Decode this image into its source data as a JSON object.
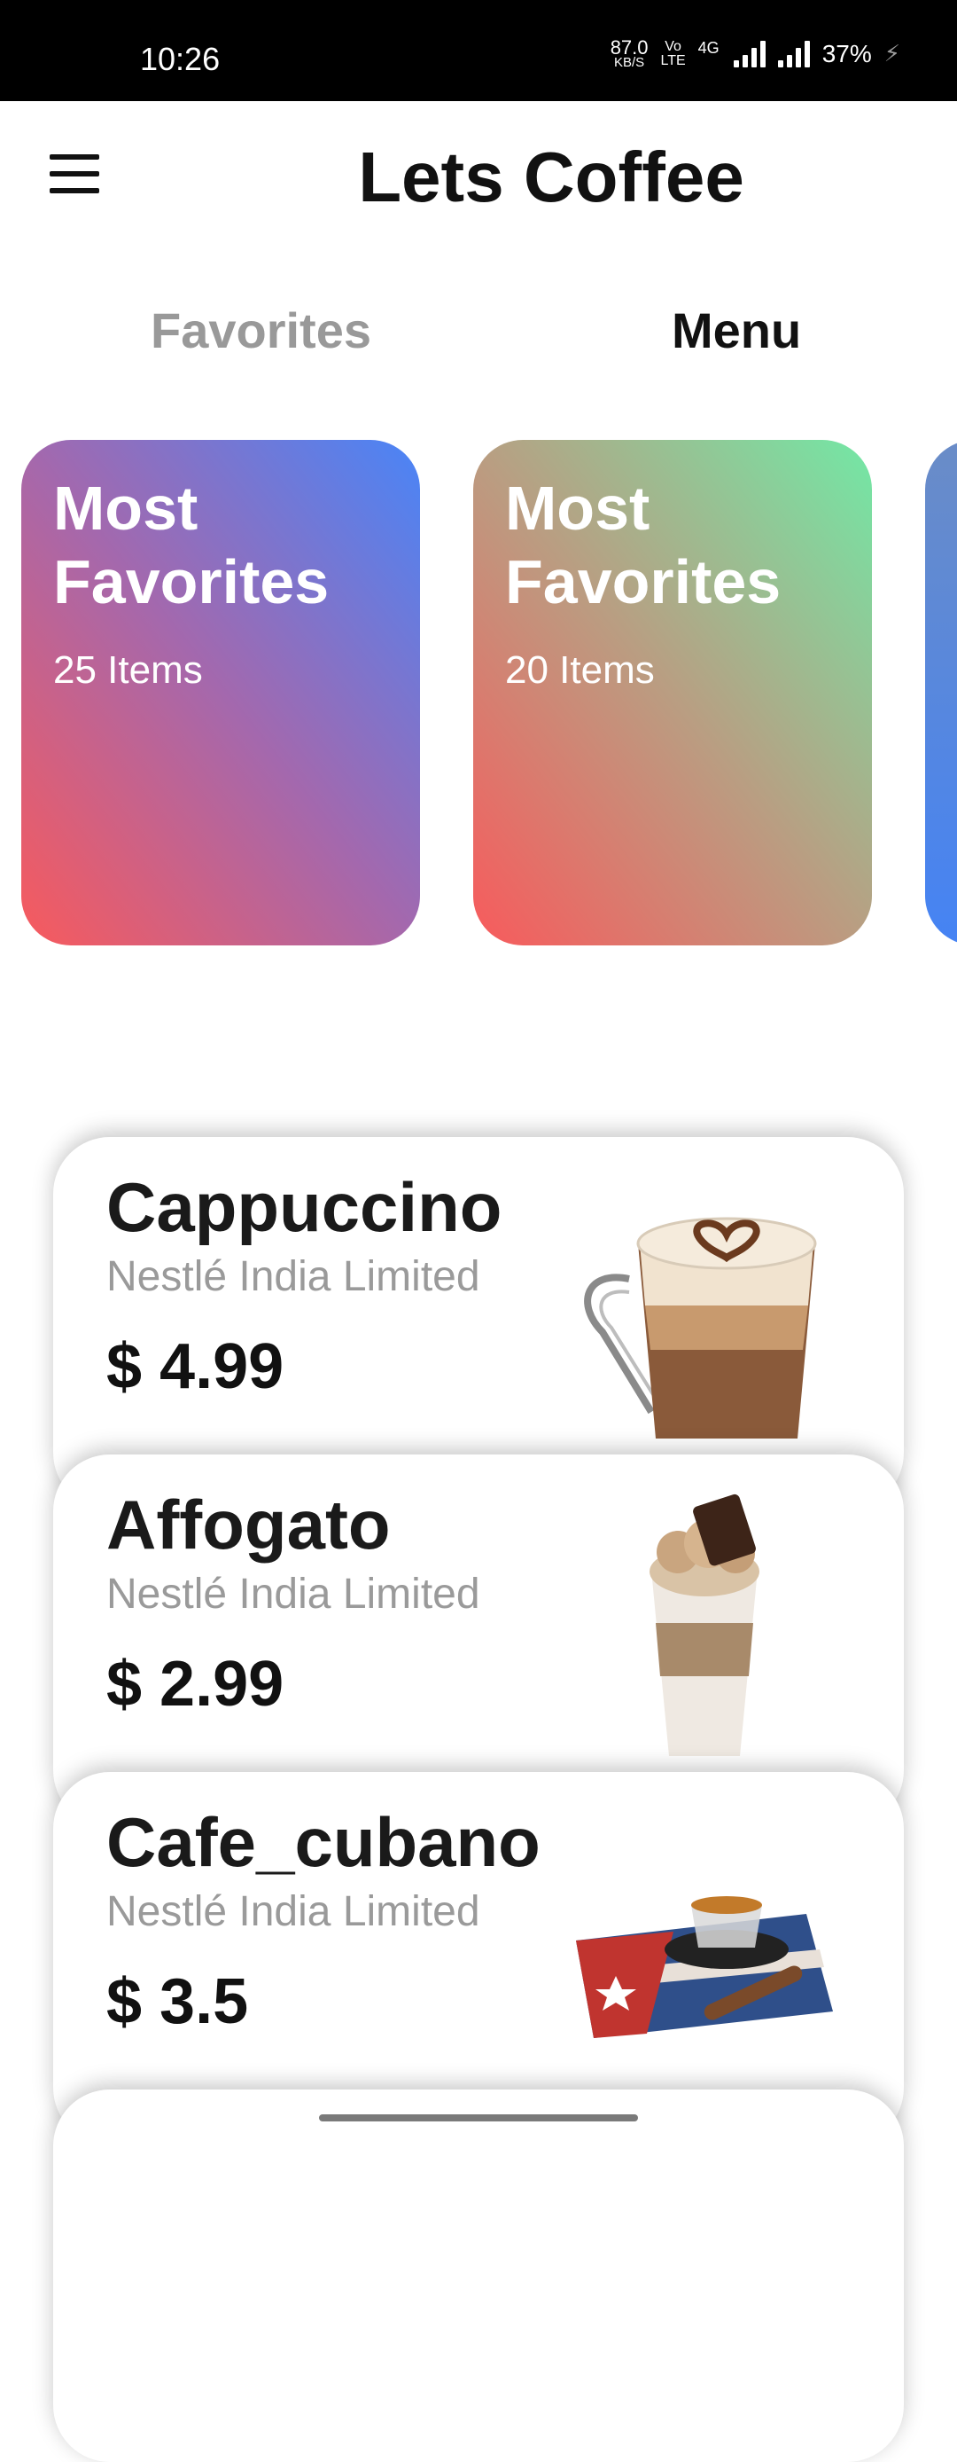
{
  "status_bar": {
    "time": "10:26",
    "net_speed_value": "87.0",
    "net_speed_unit": "KB/S",
    "volte_top": "Vo",
    "volte_bottom": "LTE",
    "network_type": "4G",
    "battery": "37%"
  },
  "app_bar": {
    "title": "Lets Coffee",
    "menu_icon": "hamburger-menu-icon"
  },
  "tabs": [
    {
      "label": "Favorites",
      "active": false
    },
    {
      "label": "Menu",
      "active": true
    }
  ],
  "category_cards": [
    {
      "title_line1": "Most",
      "title_line2": "Favorites",
      "count": "25 Items"
    },
    {
      "title_line1": "Most",
      "title_line2": "Favorites",
      "count": "20 Items"
    },
    {
      "title_line1": "",
      "title_line2": "",
      "count": ""
    }
  ],
  "products": [
    {
      "name": "Cappuccino",
      "brand": "Nestlé India Limited",
      "price": "$ 4.99",
      "image": "cappuccino-image"
    },
    {
      "name": "Affogato",
      "brand": "Nestlé India Limited",
      "price": "$ 2.99",
      "image": "affogato-image"
    },
    {
      "name": "Cafe_cubano",
      "brand": "Nestlé India Limited",
      "price": "$ 3.5",
      "image": "cafe-cubano-image"
    }
  ],
  "colors": {
    "status_bar_bg": "#000000",
    "text_primary": "#111111",
    "text_muted": "#999999",
    "card1_gradient": [
      "#f85a5c",
      "#a468ad",
      "#4985f7"
    ],
    "card2_gradient": [
      "#f85a5c",
      "#b99e82",
      "#72e8a6"
    ],
    "card3_gradient": [
      "#6a8cc7",
      "#4583f4"
    ]
  }
}
